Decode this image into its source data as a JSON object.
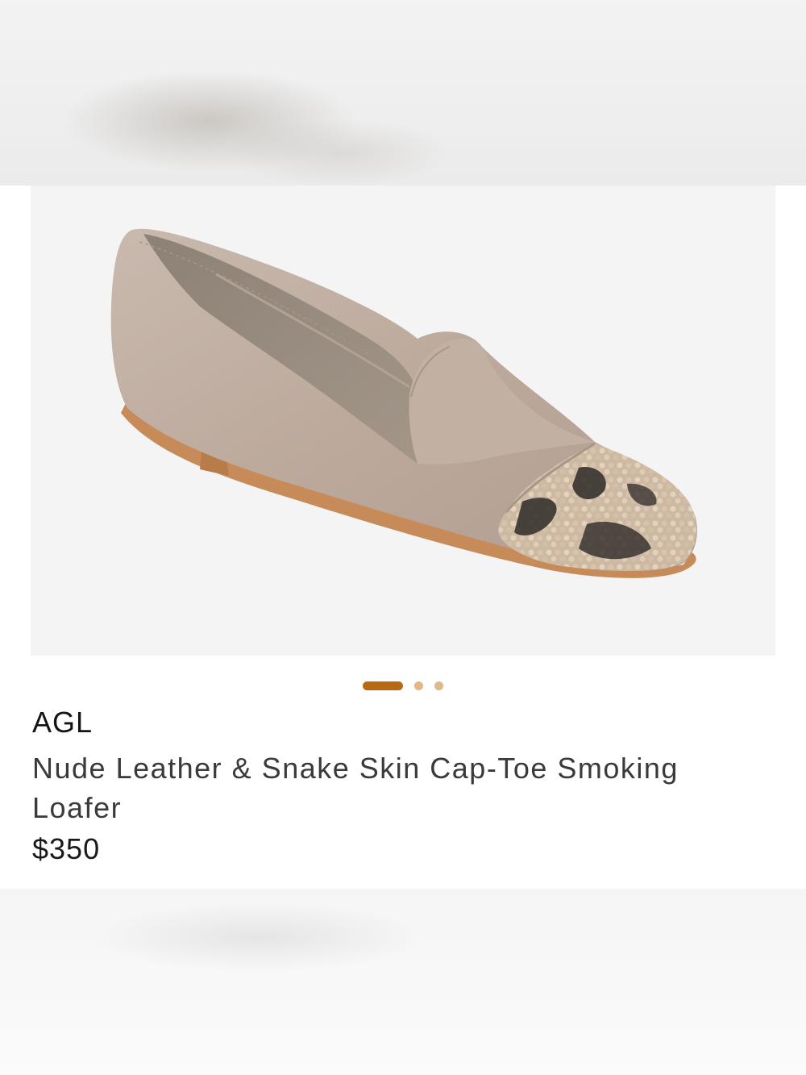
{
  "product": {
    "brand": "AGL",
    "title": "Nude Leather & Snake Skin Cap-Toe Smoking Loafer",
    "price": "$350",
    "image_description": "loafer-image"
  },
  "carousel": {
    "total_pages": 3,
    "active_index": 0,
    "active_color": "#b86a12",
    "inactive_color": "#e2b889"
  }
}
